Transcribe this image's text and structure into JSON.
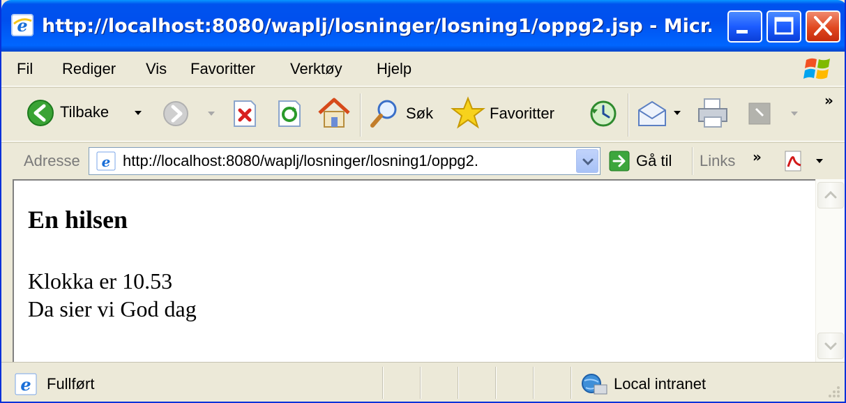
{
  "window": {
    "title": "http://localhost:8080/waplj/losninger/losning1/oppg2.jsp - Micr..."
  },
  "menubar": {
    "items": [
      "Fil",
      "Rediger",
      "Vis",
      "Favoritter",
      "Verktøy",
      "Hjelp"
    ]
  },
  "toolbar": {
    "back_label": "Tilbake",
    "search_label": "Søk",
    "favorites_label": "Favoritter",
    "overflow": "»"
  },
  "addressbar": {
    "label": "Adresse",
    "url": "http://localhost:8080/waplj/losninger/losning1/oppg2.",
    "go_label": "Gå til",
    "links_label": "Links",
    "overflow": "»"
  },
  "page": {
    "heading": "En hilsen",
    "line1": "Klokka er 10.53",
    "line2": "Da sier vi God dag"
  },
  "statusbar": {
    "status": "Fullført",
    "zone": "Local intranet"
  },
  "colors": {
    "titlebar": "#0053ee",
    "chrome": "#ece9d8",
    "close_button": "#e0471f"
  }
}
